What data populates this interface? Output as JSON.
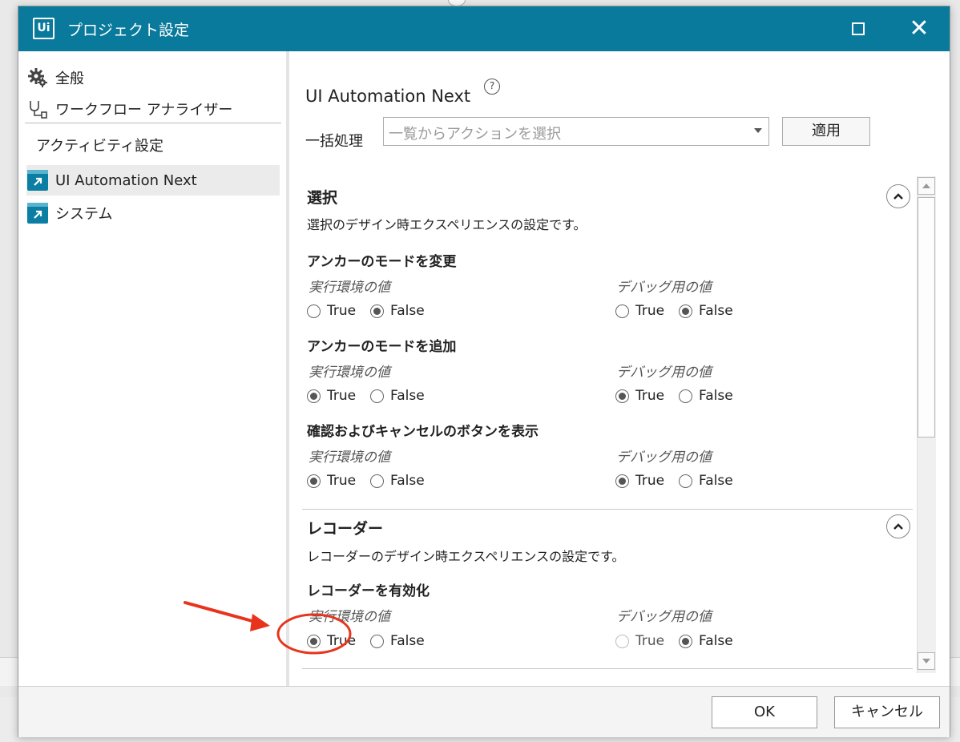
{
  "window": {
    "logo_text": "Ui",
    "title": "プロジェクト設定"
  },
  "sidebar": {
    "items": [
      {
        "label": "全般",
        "icon": "gear-icon"
      },
      {
        "label": "ワークフロー アナライザー",
        "icon": "workflow-analyzer-icon"
      }
    ],
    "heading": "アクティビティ設定",
    "activity_items": [
      {
        "label": "UI Automation Next",
        "icon": "ui-automation-package-icon",
        "selected": true
      },
      {
        "label": "システム",
        "icon": "system-package-icon",
        "selected": false
      }
    ]
  },
  "content": {
    "title": "UI Automation Next",
    "help_glyph": "?",
    "bulk_label": "一括処理",
    "bulk_placeholder": "一覧からアクションを選択",
    "apply_label": "適用",
    "sections": [
      {
        "title": "選択",
        "description": "選択のデザイン時エクスペリエンスの設定です。",
        "settings": [
          {
            "name": "アンカーのモードを変更",
            "runtime": "False",
            "debug": "False"
          },
          {
            "name": "アンカーのモードを追加",
            "runtime": "True",
            "debug": "True"
          },
          {
            "name": "確認およびキャンセルのボタンを表示",
            "runtime": "True",
            "debug": "True"
          }
        ]
      },
      {
        "title": "レコーダー",
        "description": "レコーダーのデザイン時エクスペリエンスの設定です。",
        "settings": [
          {
            "name": "レコーダーを有効化",
            "runtime": "True",
            "debug": "False"
          }
        ]
      }
    ],
    "runtime_label": "実行環境の値",
    "debug_label": "デバッグ用の値",
    "true_label": "True",
    "false_label": "False"
  },
  "footer": {
    "ok_label": "OK",
    "cancel_label": "キャンセル"
  },
  "colors": {
    "titlebar": "#097a9c",
    "annotation": "#e8341c",
    "package_icon": "#0b7fa3"
  }
}
